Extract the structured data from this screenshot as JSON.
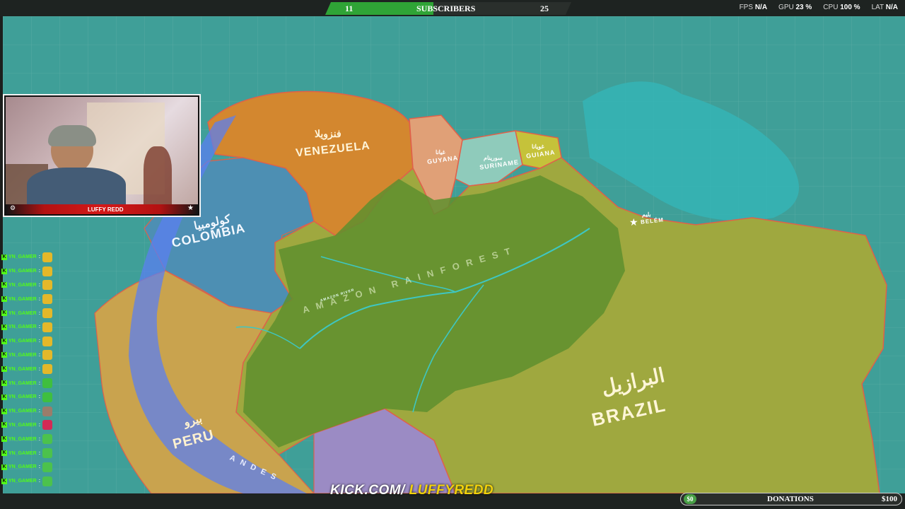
{
  "subscribers": {
    "current": "11",
    "label": "SUBSCRIBERS",
    "goal": "25",
    "progress": 0.44,
    "fill_color": "#2fa436"
  },
  "stats": [
    {
      "label": "FPS",
      "value": "N/A"
    },
    {
      "label": "GPU",
      "value": "23 %"
    },
    {
      "label": "CPU",
      "value": "100 %"
    },
    {
      "label": "LAT",
      "value": "N/A"
    }
  ],
  "map": {
    "labels": {
      "venezuela_ar": "فنزويلا",
      "venezuela": "VENEZUELA",
      "guyana_ar": "غيانا",
      "guyana": "GUYANA",
      "suriname_ar": "سورينام",
      "suriname": "SURINAME",
      "guiana_ar": "غويانا",
      "guiana": "GUIANA",
      "colombia_ar": "كولومبيا",
      "colombia": "COLOMBIA",
      "brazil_ar": "البرازيل",
      "brazil": "BRAZIL",
      "peru_ar": "بيرو",
      "peru": "PERU",
      "belem_ar": "بليم",
      "belem": "BELÉM",
      "rainforest": "AMAZON RAINFOREST",
      "andes": "ANDES",
      "amazon_river": "AMAZON RIVER"
    },
    "colors": {
      "ocean": "#3f9f98",
      "brazil": "#9fa83f",
      "forest": "#5e8f2e",
      "venezuela": "#d3872f",
      "colombia": "#4d8fb3",
      "peru": "#c9a34e",
      "guyana": "#e0a077",
      "suriname": "#8fcbbb",
      "guiana": "#c5c23a",
      "bolivia": "#9b8bc4",
      "river": "#3ec7c2",
      "andes": "#5b7ff0"
    }
  },
  "webcam": {
    "streamer_name": "LUFFY REDD"
  },
  "chat": {
    "username": "YN_GAMER",
    "separator": ":",
    "badge": "K",
    "emote_colors": [
      "#e4b829",
      "#e4b829",
      "#e4b829",
      "#e4b829",
      "#e4b829",
      "#e4b829",
      "#e4b829",
      "#e4b829",
      "#e4b829",
      "#3fbf3f",
      "#3fbf3f",
      "#9a7d6b",
      "#d42a55",
      "#4cc24c",
      "#4cc24c",
      "#4cc24c",
      "#4cc24c"
    ]
  },
  "footer": {
    "kick_prefix": "KICK.COM/",
    "kick_channel": "LUFFYREDD",
    "donations": {
      "low": "$0",
      "label": "DONATIONS",
      "high": "$100"
    }
  }
}
